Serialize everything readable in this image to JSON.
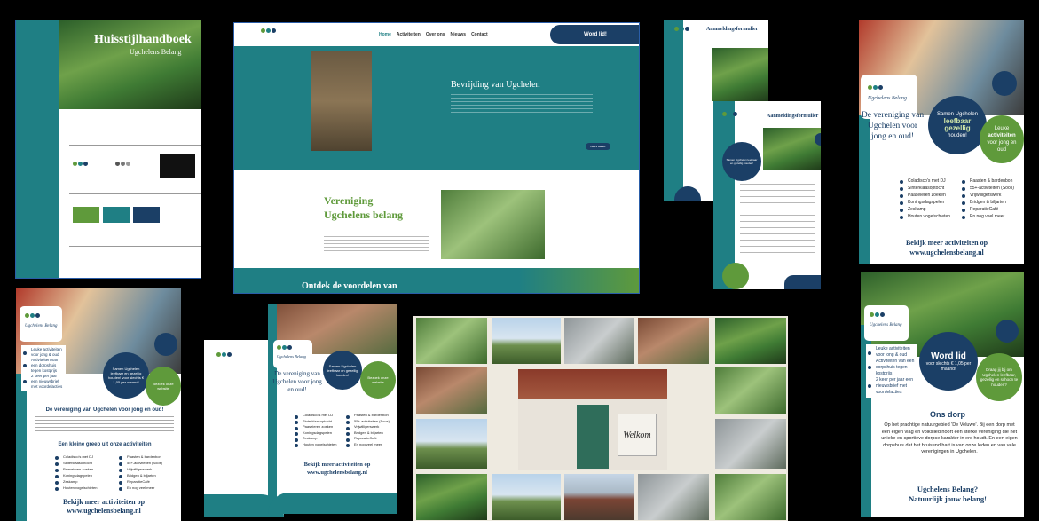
{
  "handbook": {
    "title": "Huisstijlhandboek",
    "subtitle": "Ugchelens Belang",
    "logo_label": "Ugchelens Belang"
  },
  "website": {
    "nav": [
      "Home",
      "Activiteiten",
      "Over ons",
      "Nieuws",
      "Contact"
    ],
    "cta": "Word lid!",
    "hero_title": "Bevrijding van Ugchelen",
    "hero_button": "LEES MEER",
    "section_title_line1": "Vereniging",
    "section_title_line2": "Ugchelens belang",
    "footer_title": "Ontdek de voordelen van"
  },
  "form": {
    "title": "Aanmeldingsformulier",
    "bubble": "Samen Ugchelen leefbaar en gezellig houden!"
  },
  "poster_right_top": {
    "logo": "Ugchelens Belang",
    "headline": "De vereniging van Ugchelen voor jong en oud!",
    "bubble_dark_line1": "Samen Ugchelen",
    "bubble_dark_bold": "leefbaar",
    "bubble_dark_and": "en",
    "bubble_dark_bold2": "gezellig",
    "bubble_dark_end": "houden!",
    "bubble_green_line1": "Leuke",
    "bubble_green_bold": "activiteiten",
    "bubble_green_end": "voor jong en oud",
    "activities_left": [
      "Coladisco's met DJ",
      "Sinterklaasoptocht",
      "Paaseieren zoeken",
      "Koningsdagspelen",
      "Zeskamp",
      "Houten vogelschieten"
    ],
    "activities_right": [
      "Paasten & bardenbon",
      "55+-activiteiten (Soos)",
      "Vrijwilligerswerk",
      "Bridgen & biljarten",
      "ReparatieCafé",
      "En nog veel meer"
    ],
    "footer_line1": "Bekijk meer activiteiten op",
    "footer_line2": "www.ugchelensbelang.nl"
  },
  "poster_left_bottom": {
    "logo": "Ugchelens Belang",
    "bullets": [
      "Leuke activiteiten voor jong & oud",
      "Activiteiten van een dorpshuis tegen kostprijs",
      "2 keer per jaar een nieuwsbrief met voordelacties"
    ],
    "bubble_dark": "Samen Ugchelen leefbaar en gezellig houden! voor slechts € 1,05 per maand!",
    "bubble_green": "Bezoek onze website",
    "headline": "De vereniging van Ugchelen voor jong en oud!",
    "sub": "Een kleine greep uit onze activiteiten",
    "activities_left": [
      "Coladisco's met DJ",
      "Sinterklaasoptocht",
      "Paaseieren zoeken",
      "Koningsdagspelen",
      "Zeskamp",
      "Houten vogelschieten"
    ],
    "activities_right": [
      "Paasten & bardenbon",
      "55+-activiteiten (Soos)",
      "Vrijwilligerswerk",
      "Bridgen & biljarten",
      "ReparatieCafé",
      "En nog veel meer"
    ],
    "footer_line1": "Bekijk meer activiteiten op",
    "footer_line2": "www.ugchelensbelang.nl"
  },
  "leaflet_center": {
    "logo": "Ugchelens Belang",
    "headline": "De vereniging van Ugchelen voor jong en oud!",
    "bubble_dark": "Samen Ugchelen leefbaar en gezellig houden!",
    "bubble_green": "Bezoek onze website",
    "activities_left": [
      "Coladisco's met DJ",
      "Sinterklaasoptocht",
      "Paaseieren zoeken",
      "Koningsdagspelen",
      "Zeskamp",
      "Houten vogelschieten"
    ],
    "activities_right": [
      "Paasten & bardenbon",
      "55+-activiteiten (Soos)",
      "Vrijwilligerswerk",
      "Bridgen & biljarten",
      "ReparatieCafé",
      "En nog veel meer"
    ],
    "footer_line1": "Bekijk meer activiteiten op",
    "footer_line2": "www.ugchelensbelang.nl"
  },
  "gallery": {
    "center_sign": "Welkom"
  },
  "poster_right_bottom": {
    "logo": "Ugchelens Belang",
    "bullets": [
      "Leuke activiteiten voor jong & oud",
      "Activiteiten van een dorpshuis tegen kostprijs",
      "2 keer per jaar een nieuwsbrief met voordelacties"
    ],
    "word_lid": "Word lid",
    "word_lid_sub": "voor slechts € 1,05 per maand!",
    "green_bubble": "Draag jij bij om Ugchelen leefbaar, gezellig en schoon te houden?",
    "section_title": "Ons dorp",
    "body": "Op het prachtige natuurgebied 'De Veluwe'. Bij een dorp met een eigen vlag en volkslied hoort een sterke vereniging die het unieke en sportieve dorpse karakter in ere houdt. En een eigen dorpshuis dat het bruisend hart is van onze leden en van vele verenigingen in Ugchelen.",
    "footer_line1": "Ugchelens Belang?",
    "footer_line2": "Natuurlijk jouw belang!"
  },
  "colors": {
    "teal": "#1f7f84",
    "navy": "#1b3f66",
    "green": "#5f9a3b"
  }
}
